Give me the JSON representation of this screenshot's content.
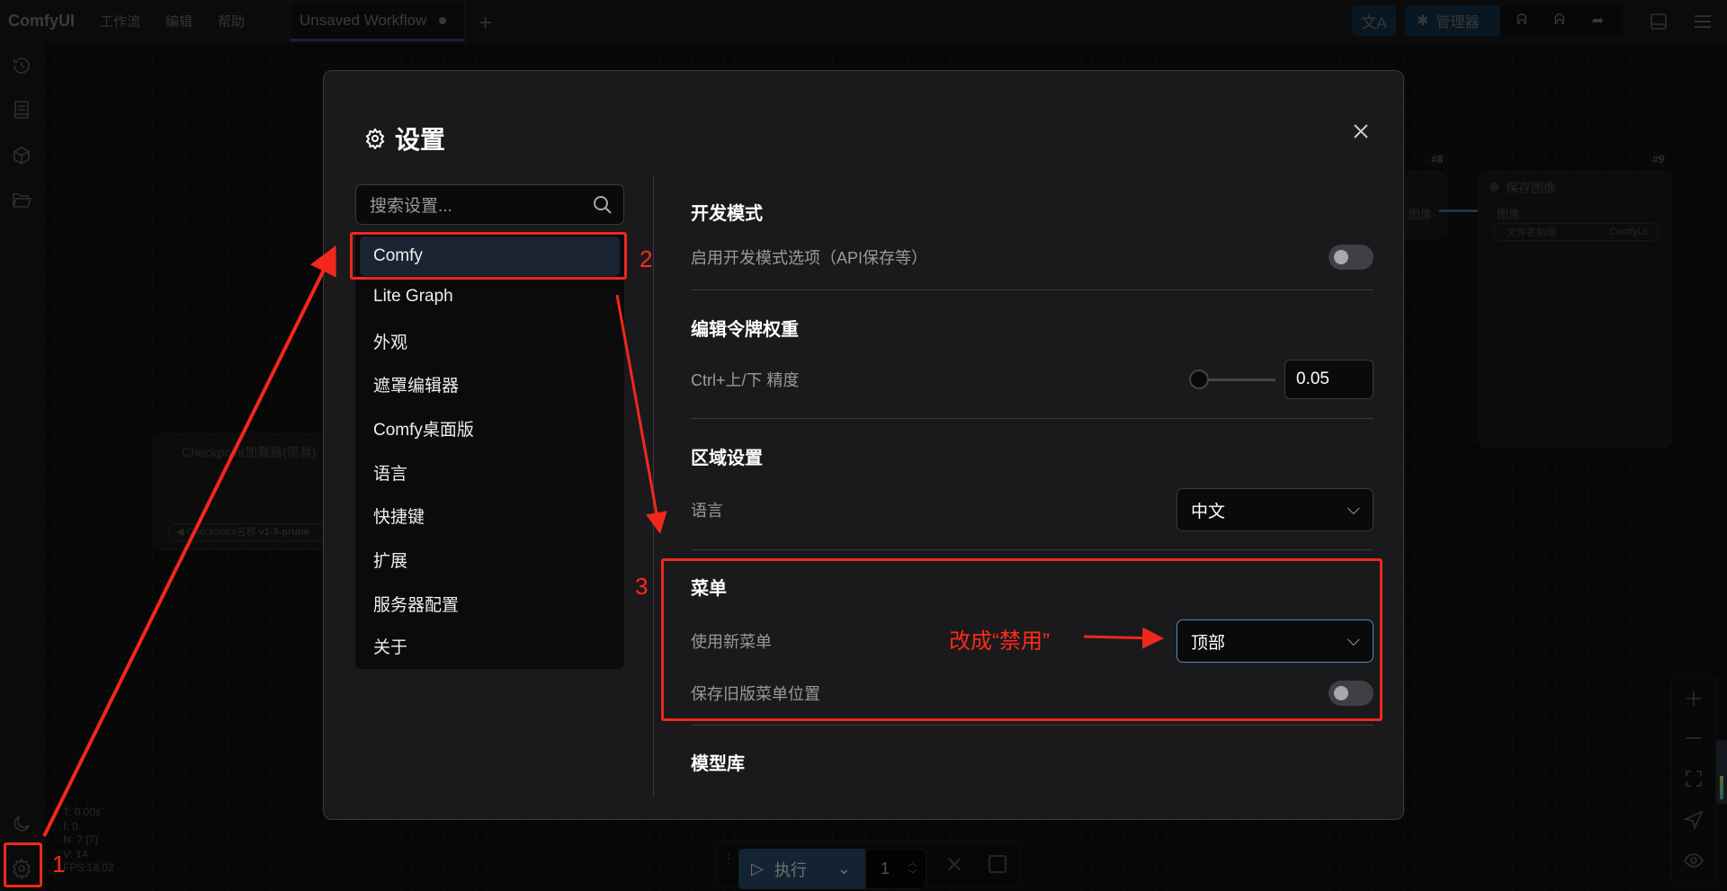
{
  "topbar": {
    "logo": "ComfyUI",
    "menus": [
      "工作流",
      "编辑",
      "帮助"
    ],
    "tab_title": "Unsaved Workflow",
    "manager_label": "管理器"
  },
  "stats": {
    "t": "T: 0.00s",
    "i": "I: 0",
    "n": "N: 7 [7]",
    "v": "V: 14",
    "fps": "FPS:18.02"
  },
  "nodes": {
    "save_image": {
      "badge": "#9",
      "title": "保存图像",
      "input": "图像",
      "widget_label": "文件名前缀",
      "widget_value": "ComfyUI"
    },
    "node8": {
      "badge": "#8",
      "output": "图像"
    },
    "checkpoint": {
      "title": "Checkpoint加载器(简易)",
      "widget_label": "Checkpoint名称",
      "widget_value": "v1-5-prune"
    }
  },
  "runbar": {
    "run_label": "执行",
    "batch_count": "1"
  },
  "settings": {
    "title": "设置",
    "search_placeholder": "搜索设置...",
    "nav": [
      "Comfy",
      "Lite Graph",
      "外观",
      "遮罩编辑器",
      "Comfy桌面版",
      "语言",
      "快捷键",
      "扩展",
      "服务器配置",
      "关于"
    ],
    "active_nav": "Comfy",
    "sections": {
      "dev": {
        "heading": "开发模式",
        "enable_label": "启用开发模式选项（API保存等）",
        "enable_value": false
      },
      "token": {
        "heading": "编辑令牌权重",
        "precision_label": "Ctrl+上/下 精度",
        "precision_value": "0.05"
      },
      "locale": {
        "heading": "区域设置",
        "language_label": "语言",
        "language_value": "中文"
      },
      "menu": {
        "heading": "菜单",
        "use_new_menu_label": "使用新菜单",
        "use_new_menu_value": "顶部",
        "save_legacy_label": "保存旧版菜单位置",
        "save_legacy_value": false
      },
      "model_library": {
        "heading": "模型库"
      }
    }
  },
  "annotations": {
    "step1": "1",
    "step2": "2",
    "step3": "3",
    "note": "改成“禁用”",
    "color": "#f0281c"
  }
}
